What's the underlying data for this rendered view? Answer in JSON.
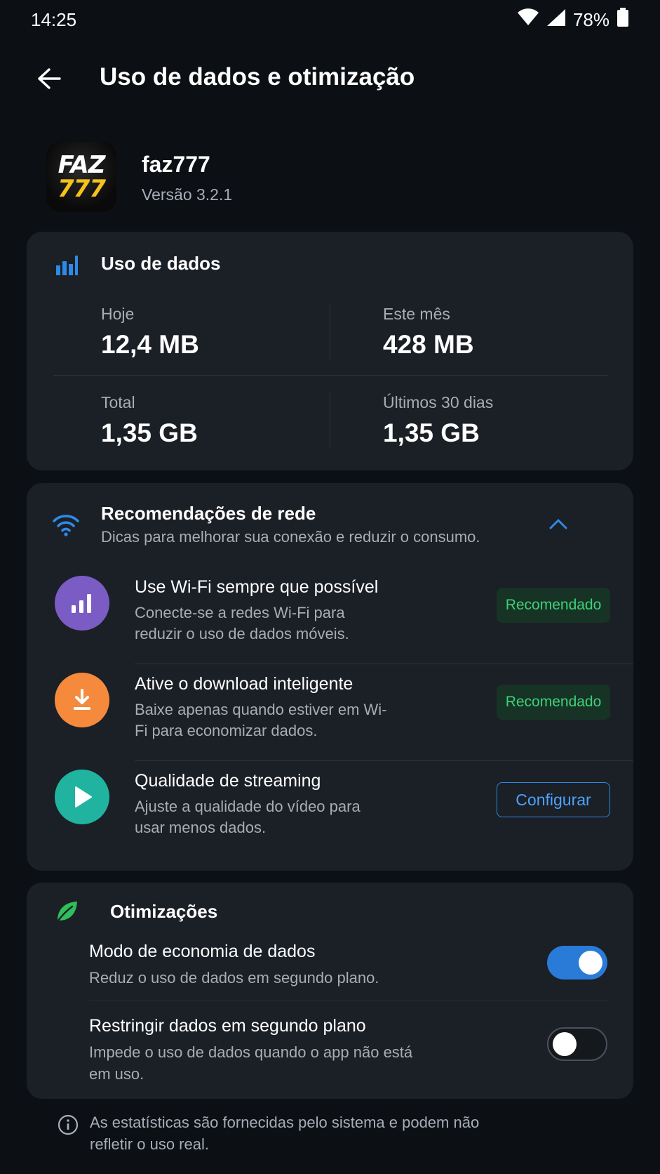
{
  "status_bar": {
    "time": "14:25",
    "battery": "78%"
  },
  "app_bar": {
    "title": "Uso de dados e otimização"
  },
  "app": {
    "name": "faz777",
    "version": "Versão 3.2.1",
    "icon_text_top": "FAZ",
    "icon_text_bottom": "777"
  },
  "usage": {
    "title": "Uso de dados",
    "stats": [
      {
        "label": "Hoje",
        "value": "12,4 MB"
      },
      {
        "label": "Este mês",
        "value": "428 MB"
      },
      {
        "label": "Total",
        "value": "1,35 GB"
      },
      {
        "label": "Últimos 30 dias",
        "value": "1,35 GB"
      }
    ]
  },
  "network": {
    "title": "Recomendações de rede",
    "subtitle": "Dicas para melhorar sua conexão e reduzir o consumo.",
    "items": [
      {
        "title": "Use Wi-Fi sempre que possível",
        "desc": "Conecte-se a redes Wi-Fi para reduzir o uso de dados móveis.",
        "action": "Recomendado",
        "icon": "bar-chart-icon",
        "color": "#7b5cc4"
      },
      {
        "title": "Ative o download inteligente",
        "desc": "Baixe apenas quando estiver em Wi-Fi para economizar dados.",
        "action": "Recomendado",
        "icon": "download-icon",
        "color": "#f58a3c"
      },
      {
        "title": "Qualidade de streaming",
        "desc": "Ajuste a qualidade do vídeo para usar menos dados.",
        "action": "Configurar",
        "icon": "play-icon",
        "color": "#1fb3a0"
      }
    ]
  },
  "optimizations": {
    "title": "Otimizações",
    "items": [
      {
        "title": "Modo de economia de dados",
        "desc": "Reduz o uso de dados em segundo plano.",
        "enabled": true
      },
      {
        "title": "Restringir dados em segundo plano",
        "desc": "Impede o uso de dados quando o app não está em uso.",
        "enabled": false
      }
    ]
  },
  "footnote": "As estatísticas são fornecidas pelo sistema e podem não refletir o uso real.",
  "colors": {
    "accent": "#2e8ae6",
    "success": "#3fd07a",
    "leaf": "#2fbf5a",
    "background": "#0c0f14",
    "card": "#1b1f26"
  }
}
